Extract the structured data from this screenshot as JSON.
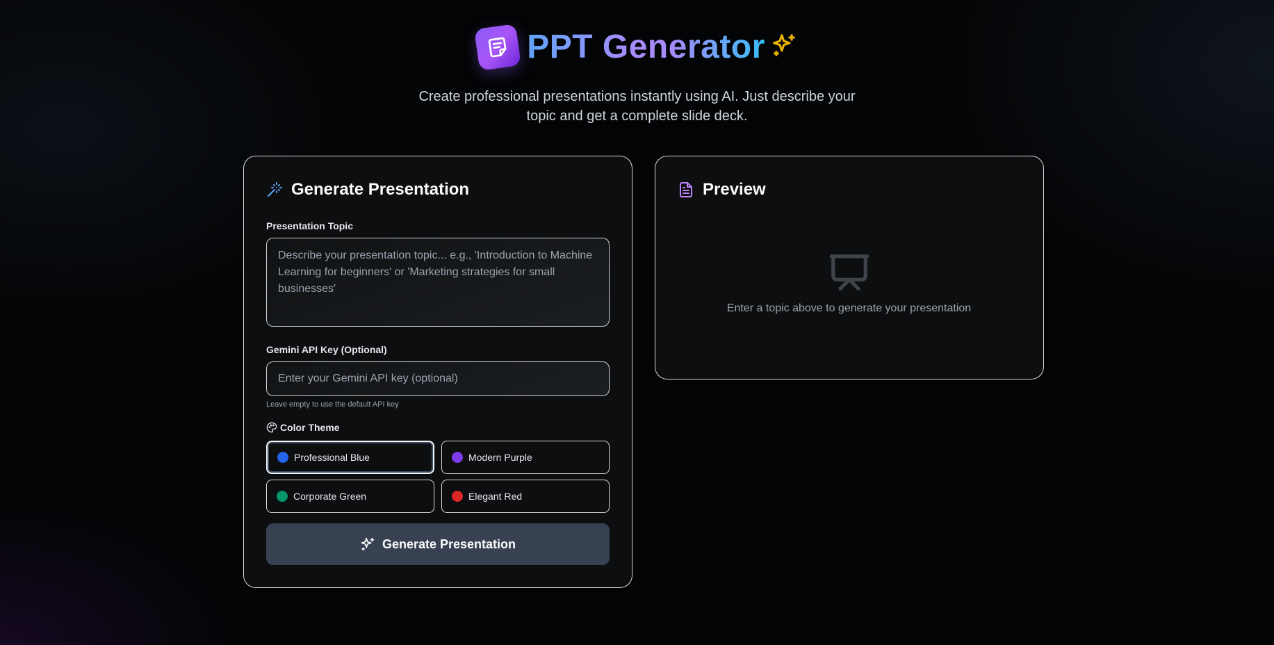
{
  "header": {
    "title": "PPT Generator",
    "subtitle": "Create professional presentations instantly using AI. Just describe your topic and get a complete slide deck.",
    "logo_icon": "document-icon",
    "title_icon": "sparkles-icon"
  },
  "generate_card": {
    "title": "Generate Presentation",
    "title_icon": "magic-wand-icon",
    "topic_label": "Presentation Topic",
    "topic_placeholder": "Describe your presentation topic... e.g., 'Introduction to Machine Learning for beginners' or 'Marketing strategies for small businesses'",
    "topic_value": "",
    "api_key_label": "Gemini API Key (Optional)",
    "api_key_placeholder": "Enter your Gemini API key (optional)",
    "api_key_value": "",
    "api_key_hint": "Leave empty to use the default API key",
    "theme_label": "Color Theme",
    "themes": [
      {
        "label": "Professional Blue",
        "color": "#2563eb",
        "selected": true
      },
      {
        "label": "Modern Purple",
        "color": "#7c3aed",
        "selected": false
      },
      {
        "label": "Corporate Green",
        "color": "#059669",
        "selected": false
      },
      {
        "label": "Elegant Red",
        "color": "#dc2626",
        "selected": false
      }
    ],
    "submit_label": "Generate Presentation"
  },
  "preview_card": {
    "title": "Preview",
    "title_icon": "file-text-icon",
    "empty_icon": "presentation-icon",
    "empty_text": "Enter a topic above to generate your presentation"
  },
  "colors": {
    "accent_purple": "#8b5cf6",
    "accent_blue": "#60a5fa",
    "sparkle_gold": "#eab308",
    "button_bg": "#374151"
  }
}
